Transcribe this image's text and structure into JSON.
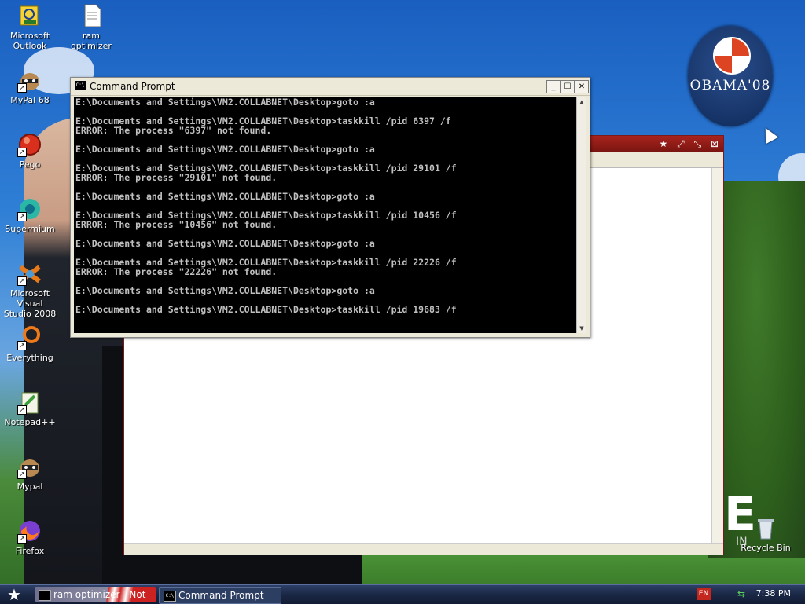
{
  "desktop": {
    "icons": [
      {
        "label": "Microsoft\nOutlook",
        "icon": "outlook-icon"
      },
      {
        "label": "ram optimizer",
        "icon": "text-file-icon"
      },
      {
        "label": "MyPal 68",
        "icon": "mypal-icon"
      },
      {
        "label": "Pego",
        "icon": "pego-icon"
      },
      {
        "label": "Supermium",
        "icon": "supermium-icon"
      },
      {
        "label": "Microsoft Visual\nStudio 2008",
        "icon": "visual-studio-icon"
      },
      {
        "label": "Everything",
        "icon": "everything-icon"
      },
      {
        "label": "Notepad++",
        "icon": "notepadpp-icon"
      },
      {
        "label": "Mypal",
        "icon": "mypal-icon"
      },
      {
        "label": "Firefox",
        "icon": "firefox-icon"
      },
      {
        "label": "Recycle Bin",
        "icon": "recycle-bin-icon"
      }
    ],
    "wallpaper": {
      "logo_text": "OBAMA'08",
      "big_letter": "E",
      "small_text": "IN"
    }
  },
  "cmd_window": {
    "title": "Command Prompt",
    "buttons": {
      "minimize": "_",
      "maximize": "☐",
      "close": "✕"
    },
    "lines": [
      "E:\\Documents and Settings\\VM2.COLLABNET\\Desktop>goto :a",
      "",
      "E:\\Documents and Settings\\VM2.COLLABNET\\Desktop>taskkill /pid 6397 /f",
      "ERROR: The process \"6397\" not found.",
      "",
      "E:\\Documents and Settings\\VM2.COLLABNET\\Desktop>goto :a",
      "",
      "E:\\Documents and Settings\\VM2.COLLABNET\\Desktop>taskkill /pid 29101 /f",
      "ERROR: The process \"29101\" not found.",
      "",
      "E:\\Documents and Settings\\VM2.COLLABNET\\Desktop>goto :a",
      "",
      "E:\\Documents and Settings\\VM2.COLLABNET\\Desktop>taskkill /pid 10456 /f",
      "ERROR: The process \"10456\" not found.",
      "",
      "E:\\Documents and Settings\\VM2.COLLABNET\\Desktop>goto :a",
      "",
      "E:\\Documents and Settings\\VM2.COLLABNET\\Desktop>taskkill /pid 22226 /f",
      "ERROR: The process \"22226\" not found.",
      "",
      "E:\\Documents and Settings\\VM2.COLLABNET\\Desktop>goto :a",
      "",
      "E:\\Documents and Settings\\VM2.COLLABNET\\Desktop>taskkill /pid 19683 /f"
    ]
  },
  "background_window": {
    "title_buttons": [
      "★",
      "⤢",
      "⤡",
      "⊠"
    ]
  },
  "taskbar": {
    "start_glyph": "★",
    "tasks": [
      {
        "label": "ram optimizer - Not",
        "active": false
      },
      {
        "label": "Command Prompt",
        "active": true
      }
    ],
    "tray": {
      "language": "EN",
      "clock": "7:38 PM"
    }
  },
  "colors": {
    "console_bg": "#000000",
    "console_fg": "#c0c0c0",
    "taskbar": "#1a2845",
    "bg_window_title": "#a8231e"
  }
}
